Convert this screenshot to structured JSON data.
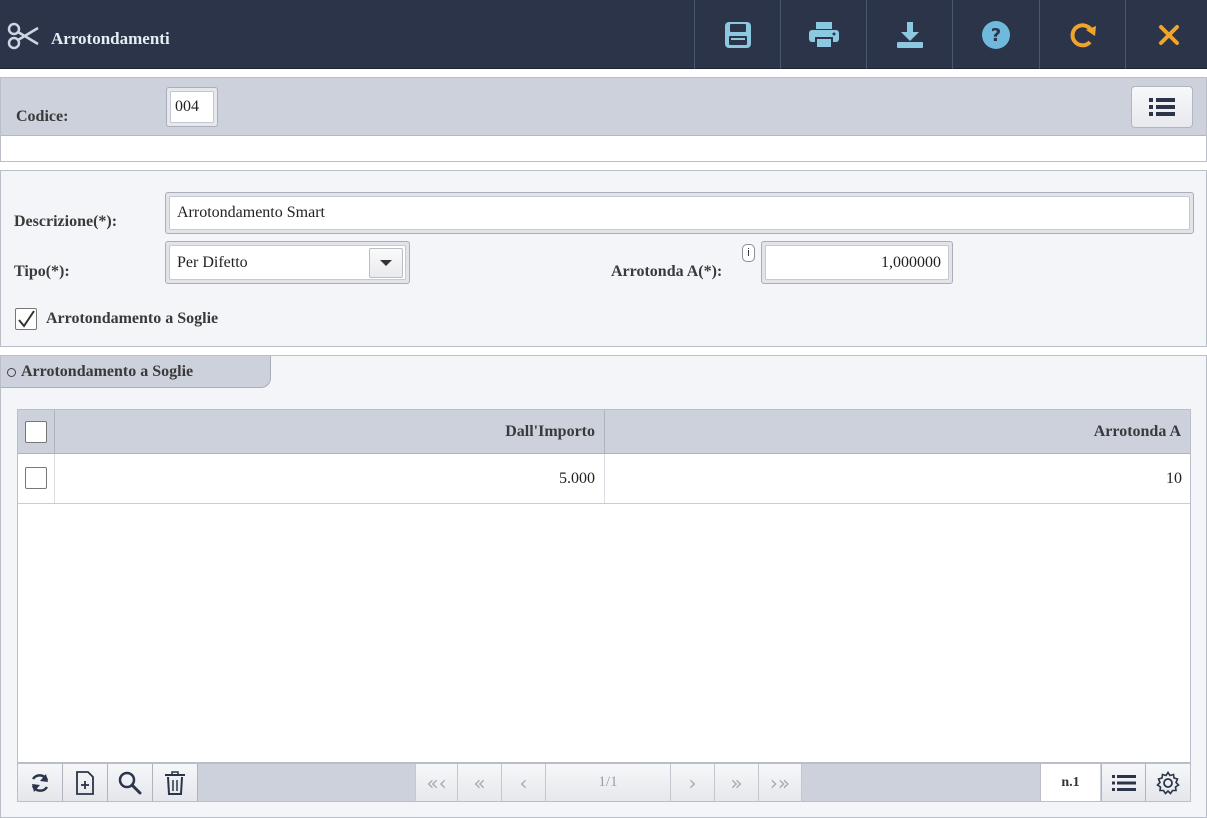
{
  "header": {
    "title": "Arrotondamenti",
    "app_icon": "scissors-icon",
    "toolbar": [
      {
        "name": "save",
        "icon": "floppy-disk-icon",
        "color": "#8cc8e0"
      },
      {
        "name": "print",
        "icon": "printer-icon",
        "color": "#8cc8e0"
      },
      {
        "name": "download",
        "icon": "download-icon",
        "color": "#8cc8e0"
      },
      {
        "name": "help",
        "icon": "question-icon",
        "color": "#6fb9dd"
      },
      {
        "name": "refresh",
        "icon": "redo-icon",
        "color": "#f0a52a"
      },
      {
        "name": "close",
        "icon": "close-icon",
        "color": "#f0a52a"
      }
    ]
  },
  "codice": {
    "label": "Codice:",
    "value": "004"
  },
  "form": {
    "descrizione_label": "Descrizione(*):",
    "descrizione_value": "Arrotondamento Smart",
    "tipo_label": "Tipo(*):",
    "tipo_value": "Per Difetto",
    "arrotonda_label": "Arrotonda A(*):",
    "arrotonda_value": "1,000000",
    "info_badge": "i",
    "soglie_checkbox_label": "Arrotondamento a Soglie",
    "soglie_checked": true
  },
  "section": {
    "title": "Arrotondamento a Soglie"
  },
  "grid": {
    "columns": [
      "Dall'Importo",
      "Arrotonda A"
    ],
    "rows": [
      {
        "dall_importo": "5.000",
        "arrotonda_a": "10"
      }
    ]
  },
  "footer": {
    "page_label": "1/1",
    "count_label": "n.1"
  }
}
